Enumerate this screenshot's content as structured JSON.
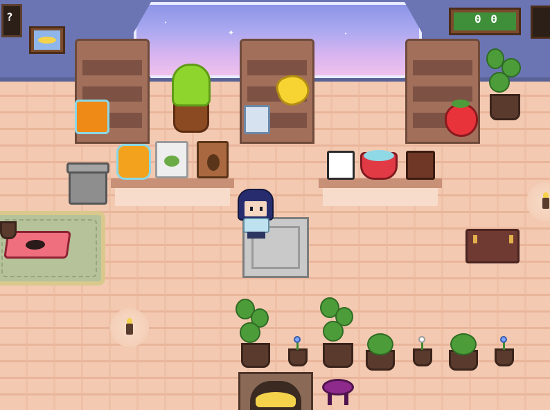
{
  "scene": {
    "name": "shop-room",
    "colors": {
      "wall": "#6c75b4",
      "floor": "#f3c9b1",
      "window_sky_top": "#8d95e6",
      "window_sky_bottom": "#f0c1ec",
      "shelf": "#a26f5b",
      "accent_green": "#4d9c3a"
    }
  },
  "hud": {
    "top_left_sign": "?"
  },
  "wall_sign": {
    "text": "0 0"
  },
  "shelves": [
    {
      "name": "left-shelf",
      "item": "honey-jar"
    },
    {
      "name": "middle-shelf",
      "items": [
        "milk-carton",
        "banana"
      ]
    },
    {
      "name": "right-shelf",
      "item": "strawberry"
    }
  ],
  "counters": [
    {
      "name": "left-counter",
      "items": [
        "honey-jar-small",
        "tea-bag",
        "coffee-bag"
      ]
    },
    {
      "name": "right-counter",
      "items": [
        "mug",
        "cake-bowl",
        "chocolate-bar"
      ]
    }
  ],
  "icons": {
    "cactus": "bunny-cactus-icon",
    "trash": "trash-can-icon",
    "chest": "treasure-chest-icon",
    "lamp": "candle-lamp-icon",
    "fireplace": "fireplace-icon",
    "stool": "stool-icon"
  }
}
